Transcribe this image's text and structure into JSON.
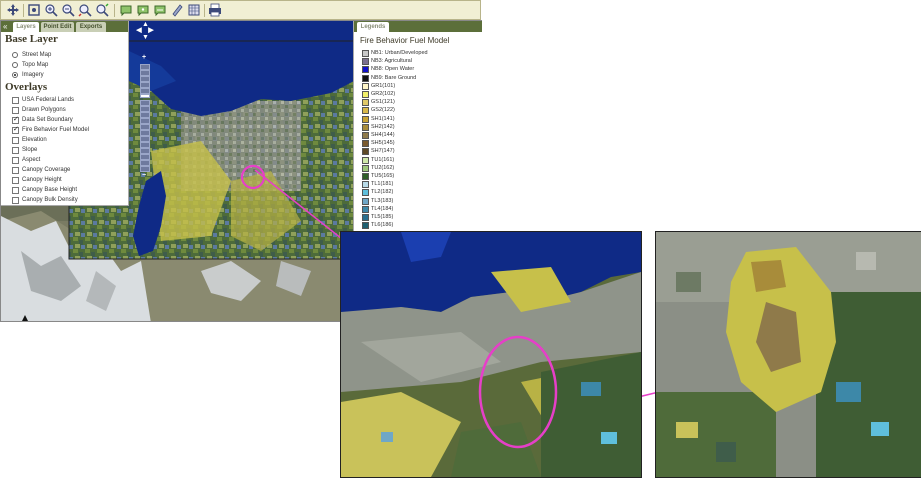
{
  "toolbar": {
    "tools": [
      "pan-icon",
      "full-extent-icon",
      "zoom-in-icon",
      "zoom-out-icon",
      "zoom-previous-icon",
      "zoom-next-icon",
      "identify-icon",
      "query-icon",
      "measure-icon",
      "clear-icon",
      "layer-list-icon",
      "print-icon"
    ]
  },
  "left_panel": {
    "collapse_glyph": "«",
    "tabs": [
      {
        "label": "Layers"
      },
      {
        "label": "Point Edit"
      },
      {
        "label": "Exports"
      }
    ],
    "base_layer_heading": "Base Layer",
    "base_layers": [
      {
        "label": "Street Map",
        "selected": false
      },
      {
        "label": "Topo Map",
        "selected": false
      },
      {
        "label": "Imagery",
        "selected": true
      }
    ],
    "overlays_heading": "Overlays",
    "overlays": [
      {
        "label": "USA Federal Lands",
        "checked": false
      },
      {
        "label": "Drawn Polygons",
        "checked": false
      },
      {
        "label": "Data Set Boundary",
        "checked": true
      },
      {
        "label": "Fire Behavior Fuel Model",
        "checked": true
      },
      {
        "label": "Elevation",
        "checked": false
      },
      {
        "label": "Slope",
        "checked": false
      },
      {
        "label": "Aspect",
        "checked": false
      },
      {
        "label": "Canopy Coverage",
        "checked": false
      },
      {
        "label": "Canopy Height",
        "checked": false
      },
      {
        "label": "Canopy Base Height",
        "checked": false
      },
      {
        "label": "Canopy Bulk Density",
        "checked": false
      }
    ]
  },
  "legend_panel": {
    "tab_label": "Legends",
    "title": "Fire Behavior Fuel Model",
    "items": [
      {
        "label": "NB1: Urban/Developed",
        "color": "#c8c8c8"
      },
      {
        "label": "NB3: Agricultural",
        "color": "#7a6f8e"
      },
      {
        "label": "NB8: Open Water",
        "color": "#1010c8"
      },
      {
        "label": "NB9: Bare Ground",
        "color": "#111111"
      },
      {
        "label": "GR1(101)",
        "color": "#fff6c8"
      },
      {
        "label": "GR2(102)",
        "color": "#f1ef6a"
      },
      {
        "label": "GS1(121)",
        "color": "#e0c868"
      },
      {
        "label": "GS2(122)",
        "color": "#d8b84a"
      },
      {
        "label": "SH1(141)",
        "color": "#c7a233"
      },
      {
        "label": "SH2(142)",
        "color": "#a88c3a"
      },
      {
        "label": "SH4(144)",
        "color": "#8f7a4a"
      },
      {
        "label": "SH5(145)",
        "color": "#7a5a2e"
      },
      {
        "label": "SH7(147)",
        "color": "#5f4a26"
      },
      {
        "label": "TU1(161)",
        "color": "#cfe8a8"
      },
      {
        "label": "TU2(162)",
        "color": "#9ec77a"
      },
      {
        "label": "TU5(165)",
        "color": "#2f5d28"
      },
      {
        "label": "TL1(181)",
        "color": "#b9dbe8"
      },
      {
        "label": "TL2(182)",
        "color": "#5fbfdc"
      },
      {
        "label": "TL3(183)",
        "color": "#6fa7c7"
      },
      {
        "label": "TL4(184)",
        "color": "#3d88a8"
      },
      {
        "label": "TL5(185)",
        "color": "#2a6f8e"
      },
      {
        "label": "TL6(186)",
        "color": "#1f5f70"
      }
    ]
  },
  "zoom": {
    "plus": "+",
    "minus": "−"
  }
}
